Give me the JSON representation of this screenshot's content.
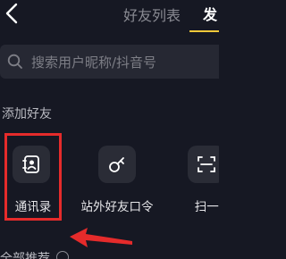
{
  "header": {
    "title": "好友列表",
    "tab_right": "发"
  },
  "search": {
    "placeholder": "搜索用户昵称/抖音号"
  },
  "add_friends": {
    "section_title": "添加好友",
    "cards": [
      {
        "label": "通讯录",
        "icon": "contacts-icon"
      },
      {
        "label": "站外好友口令",
        "icon": "key-icon"
      },
      {
        "label": "扫一扫",
        "icon": "scan-icon"
      }
    ]
  },
  "recommend": {
    "section_title": "全部推荐"
  },
  "colors": {
    "background": "#161823",
    "accent": "#f2c93a",
    "highlight": "#e52b2b"
  }
}
